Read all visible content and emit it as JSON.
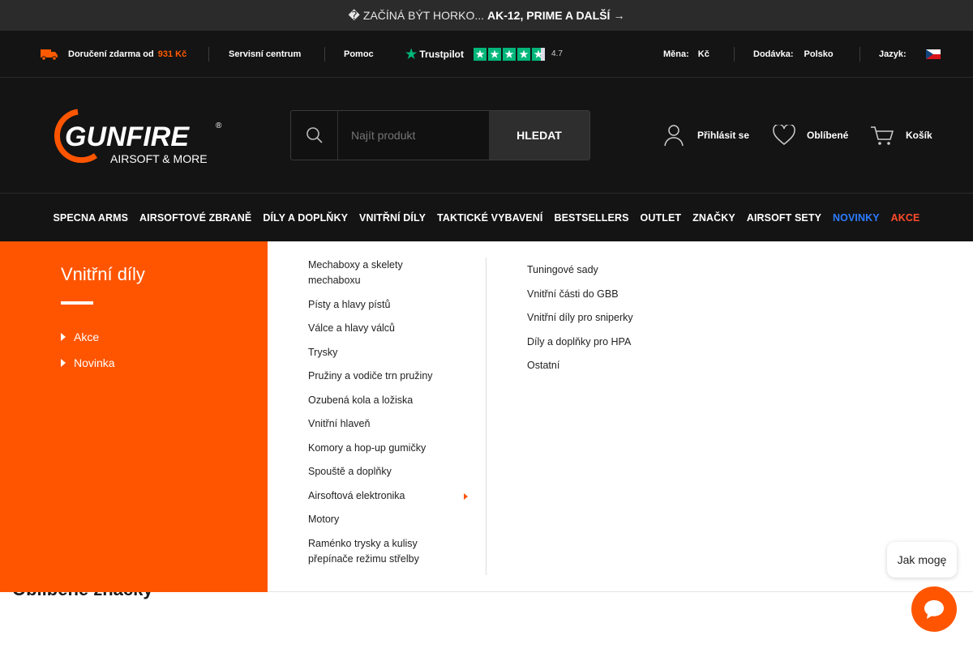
{
  "promo": {
    "prefix": "ZAČÍNÁ BÝT HORKO...",
    "highlight": "AK-12, PRIME A DALŠÍ",
    "arrow": "→"
  },
  "topbar": {
    "delivery_label": "Doručení zdarma od",
    "delivery_amount": "931 Kč",
    "service": "Servisní centrum",
    "help": "Pomoc",
    "trustpilot": "Trustpilot",
    "rating": "4.7",
    "currency_label": "Měna:",
    "currency_value": "Kč",
    "shipping_label": "Dodávka:",
    "shipping_value": "Polsko",
    "language_label": "Jazyk:"
  },
  "header": {
    "logo_main": "GUNFIRE",
    "logo_sub": "AIRSOFT & MORE",
    "search_placeholder": "Najít produkt",
    "search_button": "HLEDAT",
    "login": "Přihlásit se",
    "favorites": "Oblíbené",
    "cart": "Košík"
  },
  "nav": {
    "items": [
      "SPECNA ARMS",
      "AIRSOFTOVÉ ZBRANĚ",
      "DÍLY A DOPLŇKY",
      "VNITŘNÍ DÍLY",
      "TAKTICKÉ VYBAVENÍ",
      "BESTSELLERS",
      "OUTLET",
      "ZNAČKY",
      "AIRSOFT SETY",
      "NOVINKY",
      "AKCE"
    ]
  },
  "mega": {
    "title": "Vnitřní díly",
    "side_links": [
      "Akce",
      "Novinka"
    ],
    "col1": [
      "Mechaboxy a skelety mechaboxu",
      "Písty a hlavy pístů",
      "Válce a hlavy válců",
      "Trysky",
      "Pružiny a vodiče trn pružiny",
      "Ozubená kola a ložiska",
      "Vnitřní hlaveň",
      "Komory a hop-up gumičky",
      "Spouště a doplňky",
      "Airsoftová elektronika",
      "Motory",
      "Raménko trysky a kulisy přepínače režimu střelby"
    ],
    "col2": [
      "Tuningové sady",
      "Vnitřní části do GBB",
      "Vnitřní díly pro sniperky",
      "Díly a doplňky pro HPA",
      "Ostatní"
    ]
  },
  "brands_heading": "Oblíbené značky",
  "chat": {
    "bubble": "Jak mogę"
  },
  "colors": {
    "accent": "#ff5500",
    "dark": "#141414",
    "trustpilot": "#00b67a",
    "novinky": "#2c7cff",
    "akce": "#ff4b2b"
  }
}
